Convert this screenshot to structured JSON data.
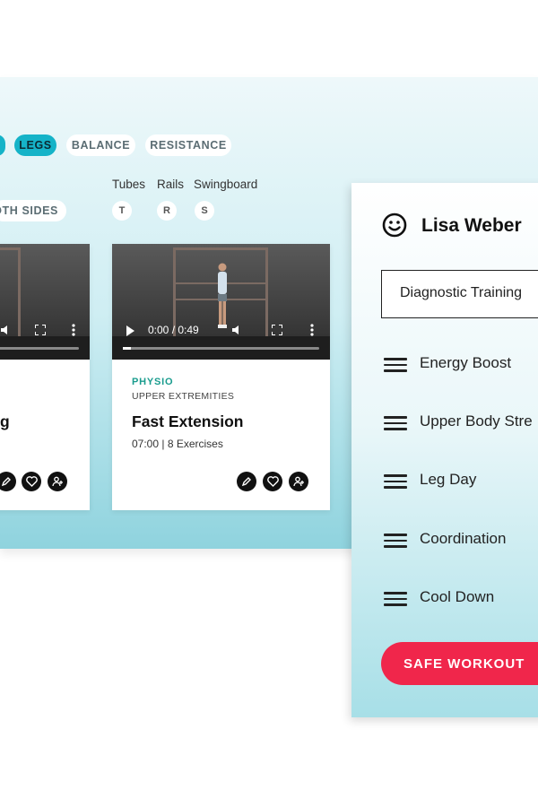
{
  "filters": {
    "categories": [
      {
        "label": "",
        "active": true
      },
      {
        "label": "LEGS",
        "active": true
      },
      {
        "label": "BALANCE",
        "active": false
      },
      {
        "label": "RESISTANCE",
        "active": false
      }
    ],
    "side_chip": "OTH SIDES",
    "equipment": [
      {
        "label": "Tubes",
        "key": "T"
      },
      {
        "label": "Rails",
        "key": "R"
      },
      {
        "label": "Swingboard",
        "key": "S"
      }
    ]
  },
  "cards": [
    {
      "category": "",
      "subcategory": "",
      "title": "g",
      "meta": "",
      "video_time": "",
      "progress": 0.0
    },
    {
      "category": "PHYSIO",
      "subcategory": "UPPER EXTREMITIES",
      "title": "Fast Extension",
      "meta": "07:00 | 8 Exercises",
      "video_time": "0:00 / 0:49",
      "progress": 0.0
    }
  ],
  "workout_panel": {
    "user_name": "Lisa Weber",
    "program": "Diagnostic Training",
    "items": [
      "Energy Boost",
      "Upper Body Stre",
      "Leg Day",
      "Coordination",
      "Cool Down"
    ],
    "save_label": "SAFE WORKOUT"
  },
  "colors": {
    "accent_teal": "#15b3c8",
    "category_green": "#1a9c8e",
    "save_red": "#f0264b"
  }
}
